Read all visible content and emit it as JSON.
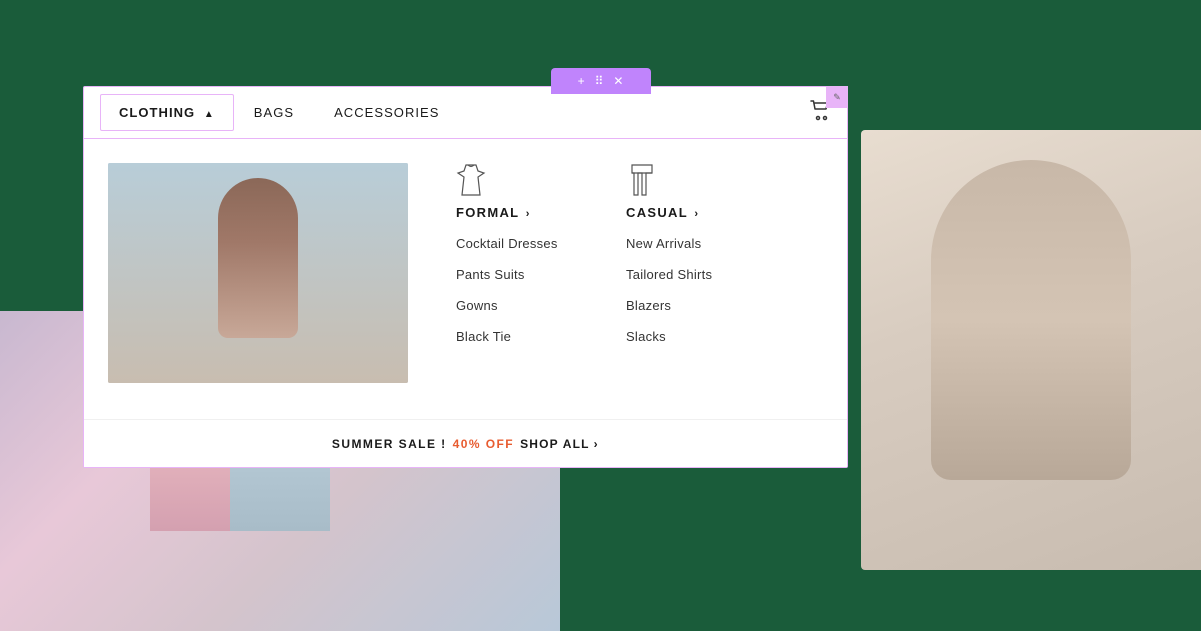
{
  "editor": {
    "toolbar": {
      "add_icon": "+",
      "move_icon": "⠿",
      "close_icon": "✕"
    },
    "edit_icon": "✎"
  },
  "navbar": {
    "items": [
      {
        "id": "clothing",
        "label": "CLOTHING",
        "active": true,
        "has_arrow": true
      },
      {
        "id": "bags",
        "label": "BAGS",
        "active": false
      },
      {
        "id": "accessories",
        "label": "ACCESSORIES",
        "active": false
      }
    ],
    "cart_icon": "🛒"
  },
  "dropdown": {
    "categories": [
      {
        "id": "formal",
        "title": "FORMAL",
        "icon": "dress",
        "links": [
          "Cocktail Dresses",
          "Pants Suits",
          "Gowns",
          "Black Tie"
        ]
      },
      {
        "id": "casual",
        "title": "CASUAL",
        "icon": "pants",
        "links": [
          "New Arrivals",
          "Tailored Shirts",
          "Blazers",
          "Slacks"
        ]
      }
    ]
  },
  "sale_banner": {
    "prefix": "SUMMER SALE !",
    "highlight": "40% OFF",
    "suffix": "SHOP ALL",
    "arrow": "›"
  }
}
